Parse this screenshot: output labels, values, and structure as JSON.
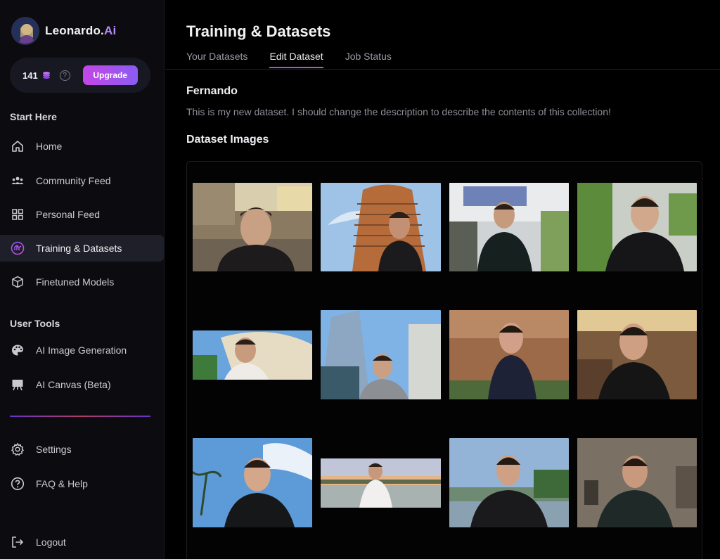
{
  "brand": {
    "name": "Leonardo.",
    "accent": "Ai"
  },
  "credits": {
    "count": "141",
    "upgrade_label": "Upgrade"
  },
  "sidebar": {
    "start_here_label": "Start Here",
    "start_items": [
      {
        "label": "Home",
        "icon": "home-icon"
      },
      {
        "label": "Community Feed",
        "icon": "community-icon"
      },
      {
        "label": "Personal Feed",
        "icon": "grid-icon"
      },
      {
        "label": "Training & Datasets",
        "icon": "training-icon",
        "active": true
      },
      {
        "label": "Finetuned Models",
        "icon": "cube-icon"
      }
    ],
    "user_tools_label": "User Tools",
    "tool_items": [
      {
        "label": "AI Image Generation",
        "icon": "palette-icon"
      },
      {
        "label": "AI Canvas (Beta)",
        "icon": "easel-icon"
      }
    ],
    "bottom_items": [
      {
        "label": "Settings",
        "icon": "gear-icon"
      },
      {
        "label": "FAQ & Help",
        "icon": "question-icon"
      },
      {
        "label": "Logout",
        "icon": "logout-icon"
      }
    ]
  },
  "main": {
    "title": "Training & Datasets",
    "tabs": [
      {
        "label": "Your Datasets"
      },
      {
        "label": "Edit Dataset",
        "active": true
      },
      {
        "label": "Job Status"
      }
    ],
    "dataset": {
      "name": "Fernando",
      "description": "This is my new dataset. I should change the description to describe the contents of this collection!",
      "images_title": "Dataset Images"
    }
  },
  "colors": {
    "accent_purple": "#8a5cf3",
    "accent_pink": "#c446e6",
    "background": "#000000",
    "sidebar_bg": "#0c0c10"
  }
}
